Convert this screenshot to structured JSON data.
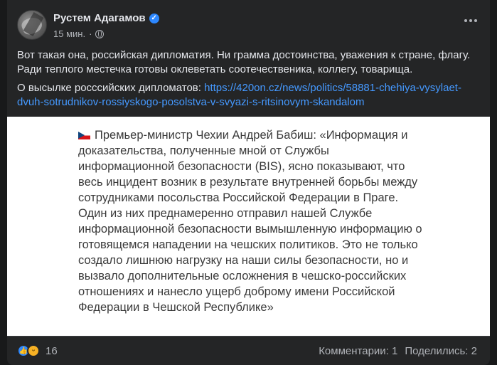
{
  "post": {
    "author": "Рустем Адагамов",
    "time": "15 мин.",
    "separator": "·",
    "paragraph1": "Вот такая она, российская дипломатия. Ни грамма достоинства, уважения к стране, флагу. Ради теплого местечка готовы оклеветать соотечественика, коллегу, товарища.",
    "paragraph2_prefix": "О высылке росссийских дипломатов: ",
    "link": "https://420on.cz/news/politics/58881-chehiya-vysylaet-dvuh-sotrudnikov-rossiyskogo-posolstva-v-svyazi-s-ritsinovym-skandalom",
    "image_text": "Премьер-министр Чехии Андрей Бабиш: «Информация и доказательства, полученные мной от Службы информационной безопасности (BIS), ясно показывают, что весь инцидент возник в результате внутренней борьбы между сотрудниками посольства Российской Федерации в Праге. Один из них преднамеренно отправил нашей Службе информационной безопасности вымышленную информацию о готовящемся нападении на чешских политиков. Это не только создало лишнюю нагрузку на наши силы безопасности, но и вызвало дополнительные осложнения в чешско-российских отношениях и нанесло ущерб доброму имени Российской Федерации в Чешской Республике»"
  },
  "footer": {
    "reactions_count": "16",
    "comments": "Комментарии: 1",
    "shares": "Поделились: 2"
  },
  "icons": {
    "verified": "verified-badge-icon",
    "privacy": "globe-icon",
    "menu": "more-options-icon",
    "reaction1": "like-icon",
    "reaction2": "haha-icon"
  },
  "colors": {
    "background": "#18191a",
    "card": "#242526",
    "link": "#4599ff",
    "verified": "#2d88ff",
    "text": "#e4e6eb",
    "secondary": "#b0b3b8"
  }
}
